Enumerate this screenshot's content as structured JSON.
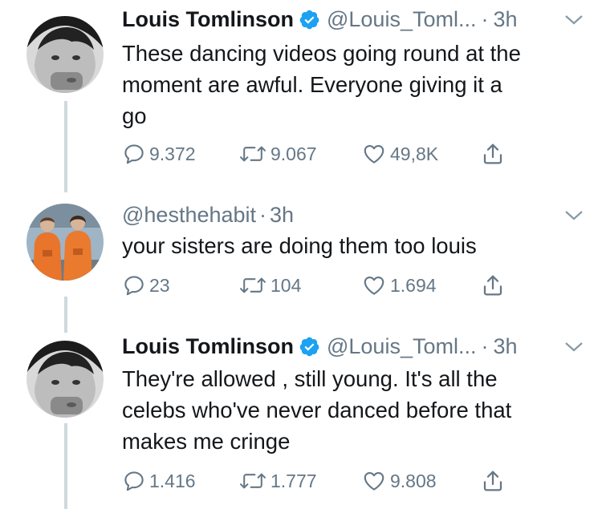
{
  "tweets": [
    {
      "name": "Louis Tomlinson",
      "verified": true,
      "handle": "@Louis_Toml...",
      "separator": "·",
      "time": "3h",
      "lines": [
        "These dancing videos going round at the",
        "moment are awful. Everyone giving it a",
        "go"
      ],
      "replies": "9.372",
      "retweets": "9.067",
      "likes": "49,8K"
    },
    {
      "name": "",
      "verified": false,
      "handle": "@hesthehabit",
      "separator": "·",
      "time": "3h",
      "lines": [
        "your sisters are doing them too louis"
      ],
      "replies": "23",
      "retweets": "104",
      "likes": "1.694"
    },
    {
      "name": "Louis Tomlinson",
      "verified": true,
      "handle": "@Louis_Toml...",
      "separator": "·",
      "time": "3h",
      "lines": [
        "They're allowed , still young. It's all the",
        "celebs who've never danced before that",
        "makes me cringe"
      ],
      "replies": "1.416",
      "retweets": "1.777",
      "likes": "9.808"
    }
  ],
  "colors": {
    "text": "#14171a",
    "muted": "#657786",
    "verified": "#1da1f2",
    "thread_line": "#cfd9de"
  },
  "icons": [
    "reply-icon",
    "retweet-icon",
    "like-icon",
    "share-icon",
    "chevron-down-icon",
    "verified-badge-icon"
  ]
}
